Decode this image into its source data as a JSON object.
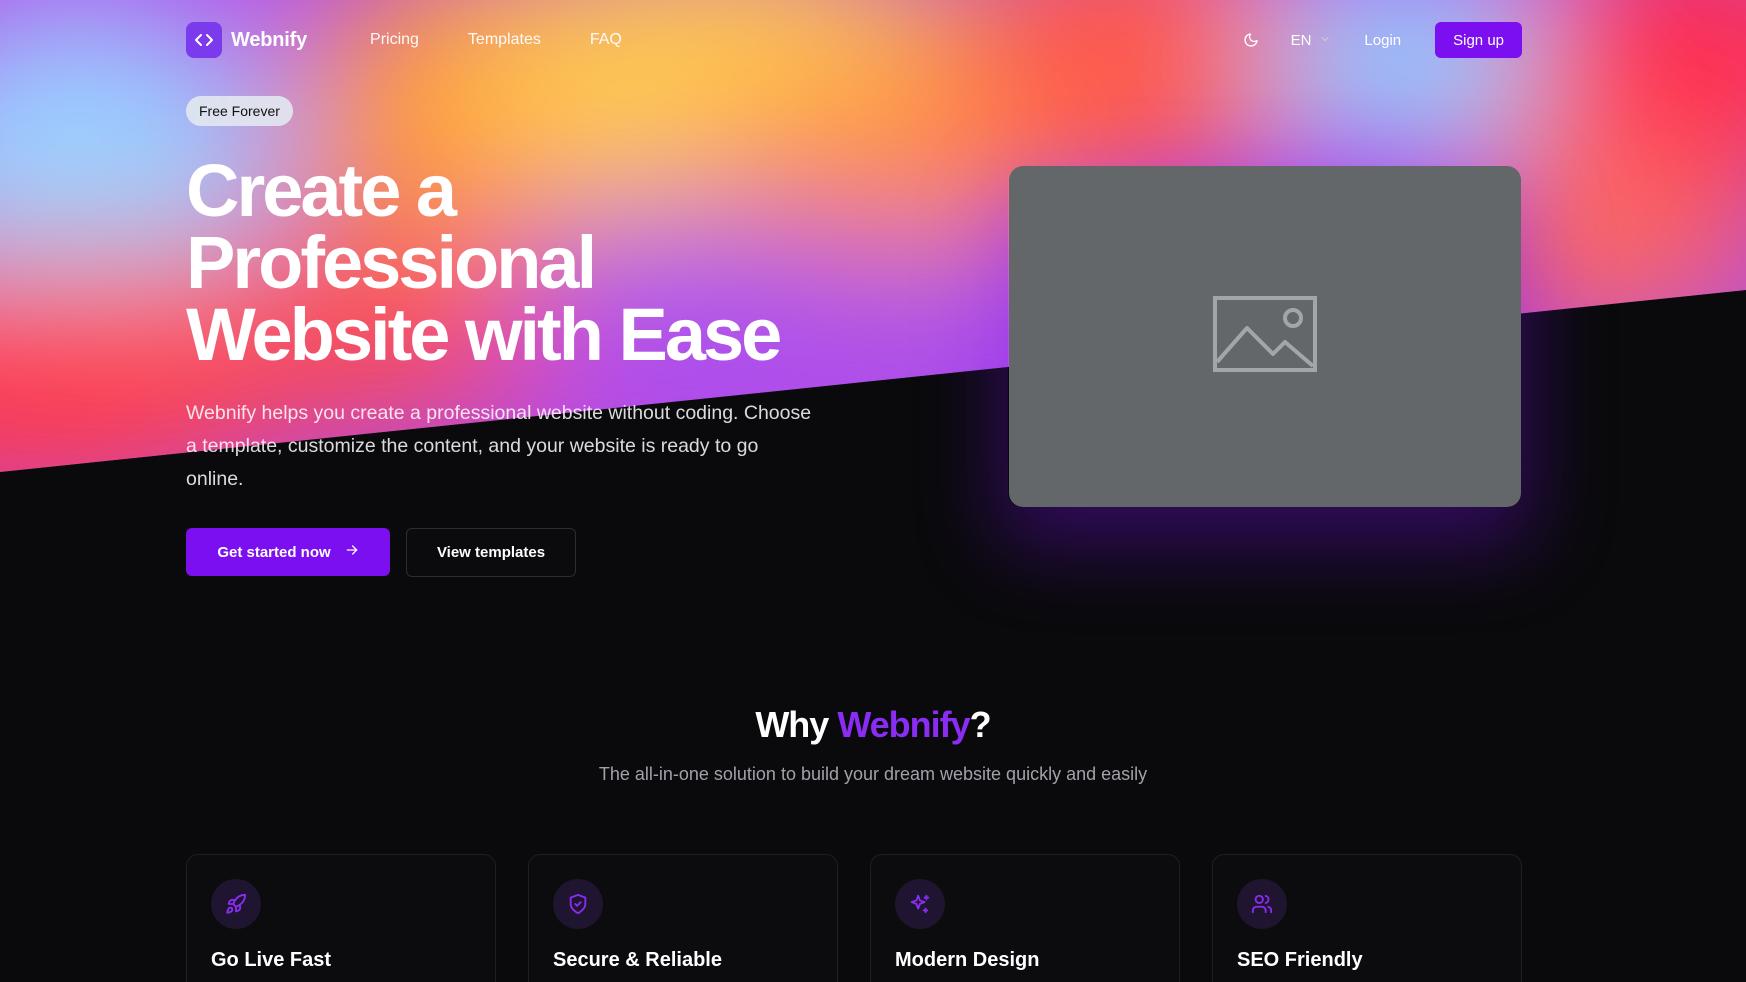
{
  "nav": {
    "brand": "Webnify",
    "links": [
      "Pricing",
      "Templates",
      "FAQ"
    ],
    "language": "EN",
    "login": "Login",
    "signup": "Sign up"
  },
  "hero": {
    "badge": "Free Forever",
    "title_line1": "Create a",
    "title_line2": "Professional",
    "title_line3": "Website with Ease",
    "description": "Webnify helps you create a professional website without coding. Choose a template, customize the content, and your website is ready to go online.",
    "cta_primary": "Get started now",
    "cta_secondary": "View templates",
    "image_icon": "image-placeholder-icon"
  },
  "why": {
    "title_prefix": "Why ",
    "title_brand": "Webnify",
    "title_suffix": "?",
    "subtitle": "The all-in-one solution to build your dream website quickly and easily"
  },
  "features": [
    {
      "title": "Go Live Fast",
      "icon": "rocket-icon"
    },
    {
      "title": "Secure & Reliable",
      "icon": "shield-icon"
    },
    {
      "title": "Modern Design",
      "icon": "sparkles-icon"
    },
    {
      "title": "SEO Friendly",
      "icon": "users-icon"
    }
  ],
  "colors": {
    "accent": "#7c0ff0",
    "accent_text": "#8b2cf5",
    "background": "#0a0a0c",
    "placeholder": "#64676a"
  }
}
